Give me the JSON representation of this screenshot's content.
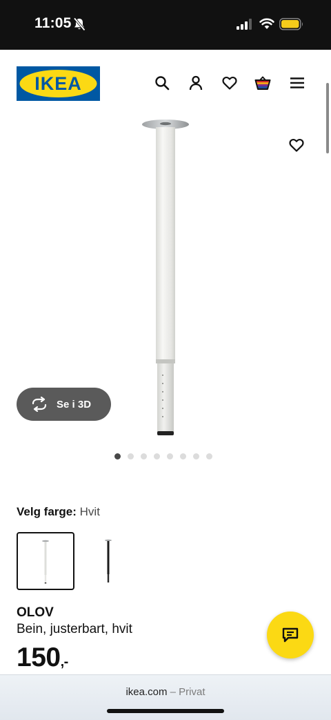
{
  "status_bar": {
    "time": "11:05",
    "icons": [
      "bell-slash-icon",
      "cellular-signal-icon",
      "wifi-icon",
      "battery-icon"
    ],
    "battery_color": "#f5cc1b"
  },
  "header": {
    "logo_text": "IKEA",
    "brand_blue": "#0058a3",
    "brand_yellow": "#fbd914",
    "icons": [
      "search-icon",
      "profile-icon",
      "heart-icon",
      "shopping-bag-icon",
      "menu-icon"
    ]
  },
  "gallery": {
    "view_3d_label": "Se i 3D",
    "image_count": 8,
    "active_index": 0
  },
  "color_choice": {
    "label": "Velg farge:",
    "value": "Hvit",
    "options": [
      "Hvit",
      "Svart"
    ],
    "selected_index": 0
  },
  "product": {
    "name": "OLOV",
    "description": "Bein, justerbart, hvit",
    "price": "150",
    "price_suffix": ",-"
  },
  "browser": {
    "domain": "ikea.com",
    "mode": " – Privat"
  }
}
